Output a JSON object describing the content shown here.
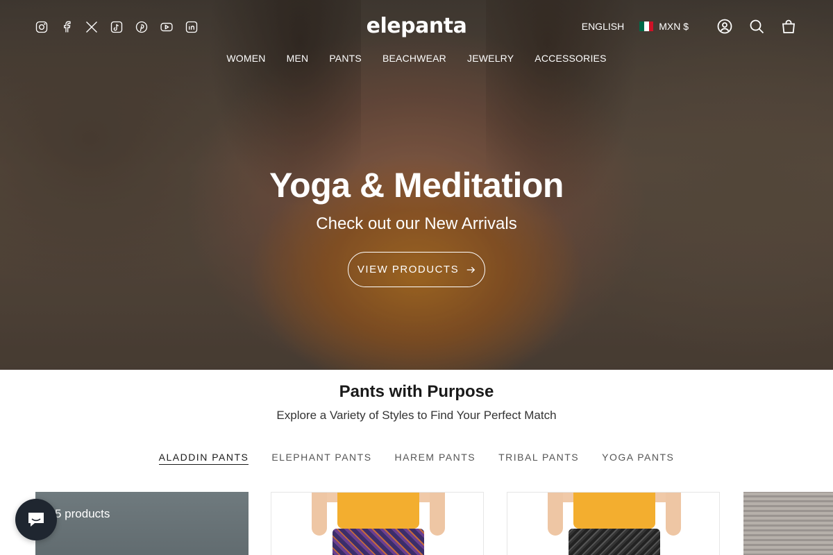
{
  "header": {
    "logo_text": "elepanta",
    "social_icons": [
      "instagram-icon",
      "facebook-icon",
      "x-icon",
      "tiktok-icon",
      "pinterest-icon",
      "youtube-icon",
      "linkedin-icon"
    ],
    "language": "ENGLISH",
    "currency": "MXN $",
    "currency_flag_colors": [
      "#006847",
      "#ffffff",
      "#ce1126"
    ],
    "icons": [
      "account-icon",
      "search-icon",
      "cart-icon"
    ]
  },
  "nav": {
    "items": [
      "WOMEN",
      "MEN",
      "PANTS",
      "BEACHWEAR",
      "JEWELRY",
      "ACCESSORIES"
    ]
  },
  "hero": {
    "title": "Yoga & Meditation",
    "subtitle": "Check out our New Arrivals",
    "button_label": "VIEW PRODUCTS"
  },
  "collection": {
    "title": "Pants with Purpose",
    "subtitle": "Explore a Variety of Styles to Find Your Perfect Match",
    "tabs": [
      "ALADDIN PANTS",
      "ELEPHANT PANTS",
      "HAREM PANTS",
      "TRIBAL PANTS",
      "YOGA PANTS"
    ],
    "active_tab": "ALADDIN PANTS",
    "promo_count": "5 products"
  },
  "chat": {
    "icon": "chat-icon",
    "color": "#1f2630"
  },
  "colors": {
    "accent_shirt": "#f3ae2f",
    "text_dark": "#1a1a1a"
  }
}
